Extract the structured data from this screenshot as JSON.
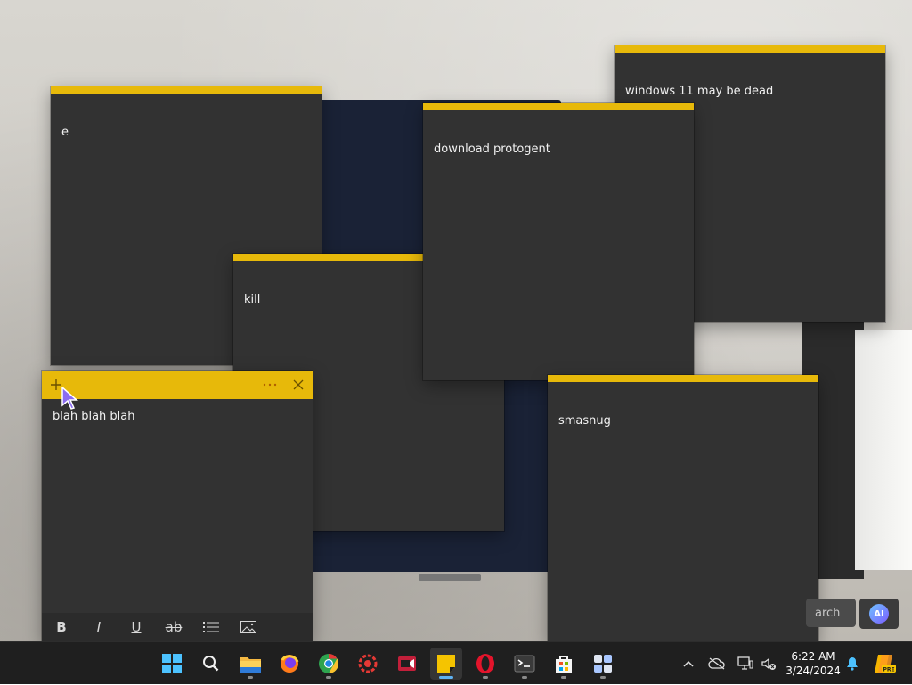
{
  "notes": [
    {
      "id": "e",
      "text": "e"
    },
    {
      "id": "kill",
      "text": "kill"
    },
    {
      "id": "win11",
      "text": "windows 11 may be dead"
    },
    {
      "id": "protogent",
      "text": "download protogent"
    },
    {
      "id": "smasnug",
      "text": "smasnug"
    },
    {
      "id": "blah",
      "text": "blah blah blah"
    }
  ],
  "active_note": {
    "add_icon": "plus-icon",
    "menu_icon": "more-icon",
    "close_icon": "close-icon",
    "format_buttons": [
      "bold",
      "italic",
      "underline",
      "strikethrough",
      "bullets",
      "image"
    ],
    "format_labels": {
      "bold": "B",
      "italic": "I",
      "underline": "U",
      "strikethrough": "ab"
    }
  },
  "desktop_overlay": {
    "search_text": "arch",
    "ai_label": "AI"
  },
  "taskbar": {
    "apps": [
      "start",
      "search",
      "file-explorer",
      "firefox",
      "chrome",
      "app-red",
      "camera-app",
      "sticky-notes",
      "opera",
      "terminal",
      "microsoft-store",
      "widgets-app"
    ],
    "active_app": "sticky-notes",
    "clock": {
      "time": "6:22 AM",
      "date": "3/24/2024"
    },
    "copilot_badge": "PRE"
  },
  "colors": {
    "note_yellow": "#e7b90a",
    "note_body": "#323232",
    "taskbar": "#1f1f1f",
    "accent": "#5fb2f2"
  }
}
